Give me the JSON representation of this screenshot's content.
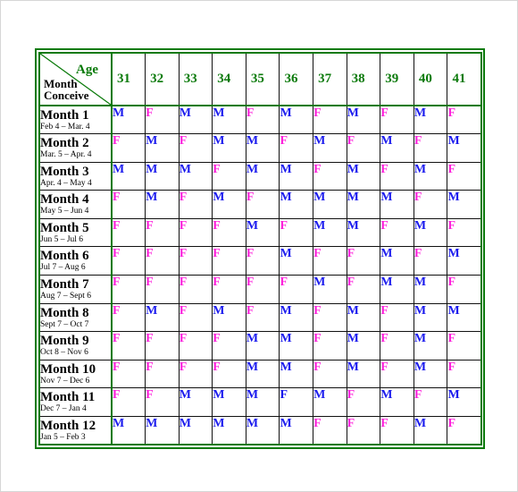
{
  "header": {
    "corner_age_label": "Age",
    "corner_month_label_line1": "Month",
    "corner_month_label_line2": "Conceive",
    "ages": [
      "31",
      "32",
      "33",
      "34",
      "35",
      "36",
      "37",
      "38",
      "39",
      "40",
      "41"
    ]
  },
  "colors": {
    "border_green": "#0a7a0a",
    "male_blue": "#1a1aee",
    "female_magenta": "#ff22dd"
  },
  "rows": [
    {
      "title": "Month 1",
      "dates": "Feb 4 – Mar. 4",
      "values": [
        "M",
        "F",
        "M",
        "M",
        "F",
        "M",
        "F",
        "M",
        "F",
        "M",
        "F"
      ],
      "colors": [
        "M",
        "F",
        "M",
        "M",
        "F",
        "M",
        "F",
        "M",
        "F",
        "M",
        "F"
      ]
    },
    {
      "title": "Month 2",
      "dates": "Mar. 5 – Apr. 4",
      "values": [
        "F",
        "M",
        "F",
        "M",
        "M",
        "F",
        "M",
        "F",
        "M",
        "F",
        "M"
      ],
      "colors": [
        "F",
        "M",
        "F",
        "M",
        "M",
        "F",
        "M",
        "F",
        "M",
        "F",
        "M"
      ]
    },
    {
      "title": "Month 3",
      "dates": "Apr. 4 – May 4",
      "values": [
        "M",
        "M",
        "M",
        "F",
        "M",
        "M",
        "F",
        "M",
        "F",
        "M",
        "F"
      ],
      "colors": [
        "M",
        "M",
        "M",
        "F",
        "M",
        "M",
        "F",
        "M",
        "F",
        "M",
        "F"
      ]
    },
    {
      "title": "Month 4",
      "dates": "May 5 – Jun 4",
      "values": [
        "F",
        "M",
        "F",
        "M",
        "F",
        "M",
        "M",
        "M",
        "M",
        "F",
        "M"
      ],
      "colors": [
        "F",
        "M",
        "F",
        "M",
        "F",
        "M",
        "M",
        "M",
        "M",
        "F",
        "M"
      ]
    },
    {
      "title": "Month 5",
      "dates": "Jun 5 – Jul 6",
      "values": [
        "F",
        "F",
        "F",
        "F",
        "M",
        "F",
        "M",
        "M",
        "F",
        "M",
        "F"
      ],
      "colors": [
        "F",
        "F",
        "F",
        "F",
        "M",
        "F",
        "M",
        "M",
        "F",
        "M",
        "F"
      ]
    },
    {
      "title": "Month 6",
      "dates": "Jul 7 – Aug 6",
      "values": [
        "F",
        "F",
        "F",
        "F",
        "F",
        "M",
        "F",
        "F",
        "M",
        "F",
        "M"
      ],
      "colors": [
        "F",
        "F",
        "F",
        "F",
        "F",
        "M",
        "F",
        "F",
        "M",
        "F",
        "M"
      ]
    },
    {
      "title": "Month 7",
      "dates": "Aug 7 – Sept 6",
      "values": [
        "F",
        "F",
        "F",
        "F",
        "F",
        "F",
        "M",
        "F",
        "M",
        "M",
        "F"
      ],
      "colors": [
        "F",
        "F",
        "F",
        "F",
        "F",
        "F",
        "M",
        "F",
        "M",
        "M",
        "F"
      ]
    },
    {
      "title": "Month 8",
      "dates": "Sept 7 – Oct 7",
      "values": [
        "F",
        "M",
        "F",
        "M",
        "F",
        "M",
        "F",
        "M",
        "F",
        "M",
        "M"
      ],
      "colors": [
        "F",
        "M",
        "F",
        "M",
        "F",
        "M",
        "F",
        "M",
        "F",
        "M",
        "M"
      ]
    },
    {
      "title": "Month 9",
      "dates": "Oct 8 – Nov 6",
      "values": [
        "F",
        "F",
        "F",
        "F",
        "M",
        "M",
        "F",
        "M",
        "F",
        "M",
        "F"
      ],
      "colors": [
        "F",
        "F",
        "F",
        "F",
        "M",
        "M",
        "F",
        "M",
        "F",
        "M",
        "F"
      ]
    },
    {
      "title": "Month 10",
      "dates": "Nov 7 – Dec 6",
      "values": [
        "F",
        "F",
        "F",
        "F",
        "M",
        "M",
        "F",
        "M",
        "F",
        "M",
        "F"
      ],
      "colors": [
        "F",
        "F",
        "F",
        "F",
        "M",
        "M",
        "F",
        "M",
        "F",
        "M",
        "F"
      ]
    },
    {
      "title": "Month 11",
      "dates": "Dec 7 – Jan 4",
      "values": [
        "F",
        "F",
        "M",
        "M",
        "M",
        "F",
        "M",
        "F",
        "M",
        "F",
        "M"
      ],
      "colors": [
        "F",
        "F",
        "M",
        "M",
        "M",
        "M",
        "M",
        "F",
        "M",
        "F",
        "M"
      ]
    },
    {
      "title": "Month 12",
      "dates": "Jan 5 – Feb 3",
      "values": [
        "M",
        "M",
        "M",
        "M",
        "M",
        "M",
        "F",
        "F",
        "F",
        "M",
        "F"
      ],
      "colors": [
        "M",
        "M",
        "M",
        "M",
        "M",
        "M",
        "F",
        "F",
        "F",
        "M",
        "F"
      ]
    }
  ]
}
